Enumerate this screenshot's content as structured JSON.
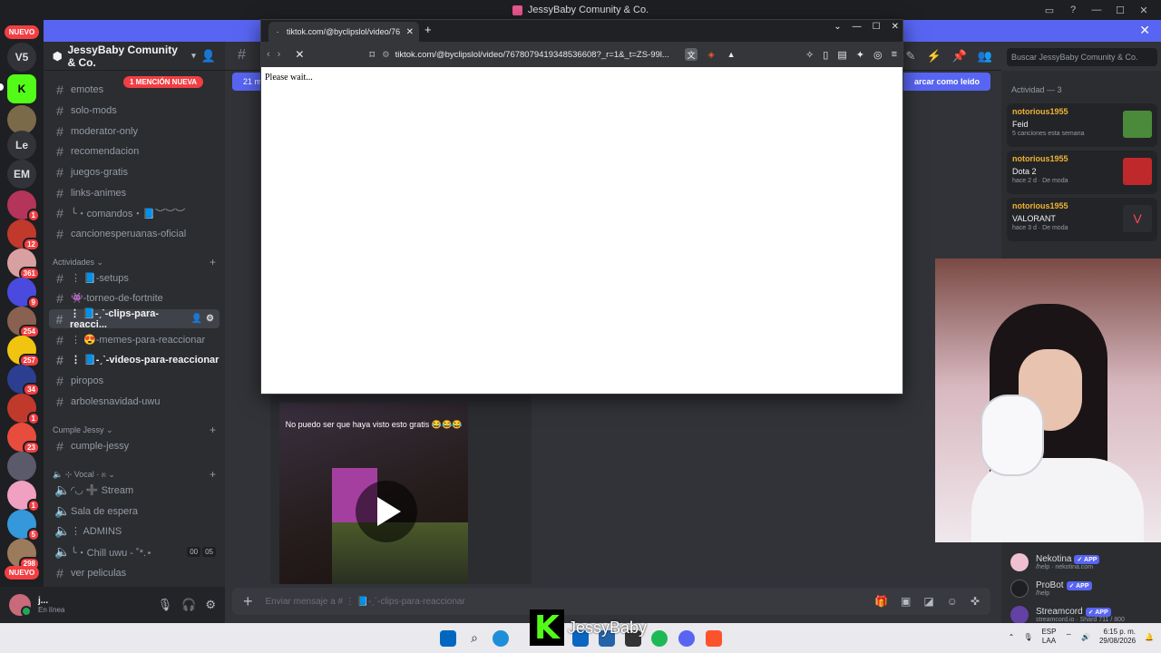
{
  "window": {
    "title": "JessyBaby Comunity & Co."
  },
  "banner": {
    "close": "✕"
  },
  "rail": {
    "new_top": "NUEVO",
    "v5": "V5",
    "le": "Le",
    "em": "EM",
    "badges": [
      "1",
      "12",
      "361",
      "9",
      "254",
      "257",
      "34",
      "1",
      "23",
      "1",
      "5",
      "298"
    ],
    "new_bottom": "NUEVO"
  },
  "server": {
    "name": "JessyBaby Comunity & Co."
  },
  "sidebar": {
    "mention_pill": "1 MENCIÓN NUEVA",
    "channels": [
      {
        "name": "emotes"
      },
      {
        "name": "solo-mods"
      },
      {
        "name": "moderator-only"
      },
      {
        "name": "recomendacion"
      },
      {
        "name": "juegos-gratis"
      },
      {
        "name": "links-animes"
      },
      {
        "name": "╰・comandos・📘︶︶︶"
      },
      {
        "name": "cancionesperuanas-oficial"
      }
    ],
    "cat_actividades": "Actividades",
    "activity_channels": [
      {
        "name": "⋮ 📘-setups"
      },
      {
        "name": "👾-torneo-de-fortnite"
      },
      {
        "name": "⋮ 📘-ˏˋ-clips-para-reacci..."
      },
      {
        "name": "⋮ 😍-memes-para-reaccionar"
      },
      {
        "name": "⋮ 📘-ˏˋ-videos-para-reaccionar"
      },
      {
        "name": "piropos"
      },
      {
        "name": "arbolesnavidad-uwu"
      }
    ],
    "cat_cumple": "Cumple Jessy",
    "cumple_channels": [
      {
        "name": "cumple-jessy"
      }
    ],
    "cat_vocal": "🔈 ⊹ Vocal · ೫",
    "voice_channels": [
      {
        "name": "◜◡ ➕ Stream"
      },
      {
        "name": "Sala de espera"
      },
      {
        "name": "⋮ ADMINS"
      },
      {
        "name": "╰・Chill uwu - ˚*.⋆"
      },
      {
        "name": "ver peliculas"
      }
    ],
    "voice_time": [
      "00",
      "05"
    ]
  },
  "user": {
    "name": "j...",
    "status": "En línea"
  },
  "chat": {
    "new_messages_left": "21 m",
    "mark_read": "arcar como leído",
    "video_caption": "No puedo ser que haya visto esto gratis 😂😂😂",
    "message_placeholder": "Enviar mensaje a # ⋮ 📘-ˏˋ-clips-para-reaccionar"
  },
  "members": {
    "search_placeholder": "Buscar JessyBaby Comunity & Co.",
    "activity_header": "Actividad — 3",
    "activities": [
      {
        "user": "notorious1955",
        "title": "Feid",
        "meta": "5 canciones esta semana"
      },
      {
        "user": "notorious1955",
        "title": "Dota 2",
        "meta": "hace 2 d · De moda"
      },
      {
        "user": "notorious1955",
        "title": "VALORANT",
        "meta": "hace 3 d · De moda"
      }
    ],
    "bots": [
      {
        "name": "Nekotina",
        "tag": "✓ APP",
        "status": "/help · nekotina.com"
      },
      {
        "name": "ProBot",
        "tag": "✓ APP",
        "status": "/help"
      },
      {
        "name": "Streamcord",
        "tag": "✓ APP",
        "status": "streamcord.io · Shard 711 / 800"
      }
    ]
  },
  "browser": {
    "tab_title": "tiktok.com/@byclipslol/video/76",
    "url": "tiktok.com/@byclipslol/video/7678079419348536608?_r=1&_t=ZS-99l...",
    "body_text": "Please wait..."
  },
  "taskbar": {
    "overlay_name": "JessyBaby",
    "lang_1": "ESP",
    "lang_2": "LAA",
    "time": "6:15 p. m.",
    "date": "29/08/2026"
  }
}
